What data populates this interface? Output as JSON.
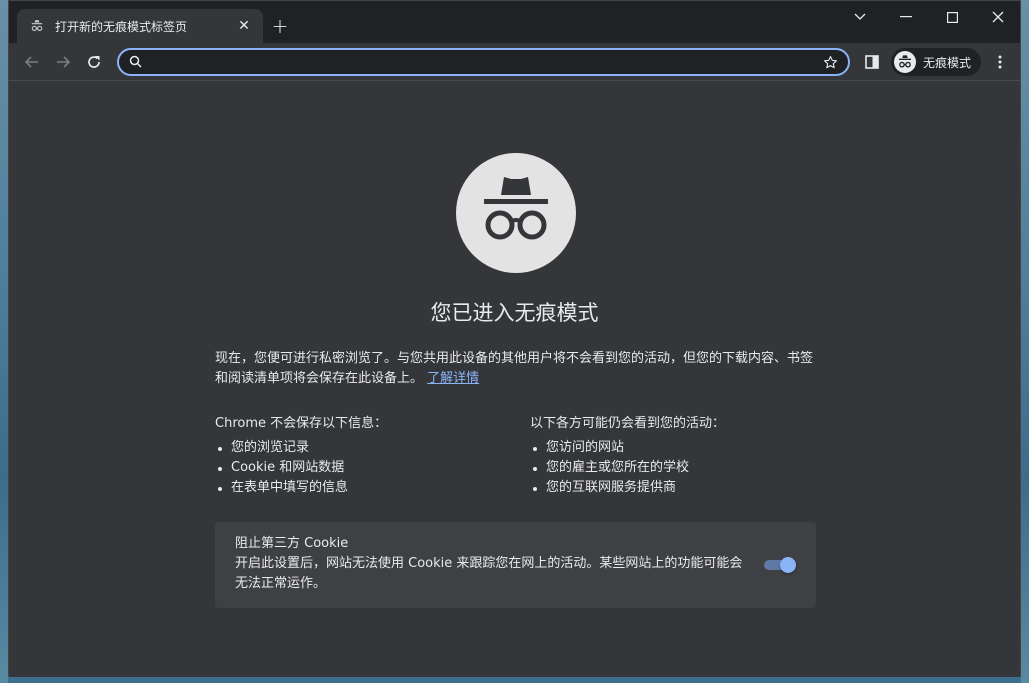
{
  "tab": {
    "title": "打开新的无痕模式标签页",
    "close_symbol": "✕",
    "new_tab_symbol": "+"
  },
  "window_controls": {
    "search_tabs_icon": "chevron-down-icon",
    "minimize_icon": "minimize-icon",
    "maximize_icon": "maximize-icon",
    "close_icon": "close-icon"
  },
  "toolbar": {
    "omnibox": {
      "value": "",
      "placeholder": ""
    },
    "incognito_chip_label": "无痕模式"
  },
  "content": {
    "heading": "您已进入无痕模式",
    "intro_text": "现在，您便可进行私密浏览了。与您共用此设备的其他用户将不会看到您的活动，但您的下载内容、书签和阅读清单项将会保存在此设备上。",
    "learn_more": "了解详情",
    "not_saved": {
      "title": "Chrome 不会保存以下信息：",
      "items": [
        "您的浏览记录",
        "Cookie 和网站数据",
        "在表单中填写的信息"
      ]
    },
    "may_see": {
      "title": "以下各方可能仍会看到您的活动：",
      "items": [
        "您访问的网站",
        "您的雇主或您所在的学校",
        "您的互联网服务提供商"
      ]
    },
    "cookie_card": {
      "title": "阻止第三方 Cookie",
      "description": "开启此设置后，网站无法使用 Cookie 来跟踪您在网上的活动。某些网站上的功能可能会无法正常运作。",
      "toggle_on": true
    }
  },
  "colors": {
    "accent": "#8ab4f8",
    "background": "#35363a",
    "frame": "#202124"
  }
}
